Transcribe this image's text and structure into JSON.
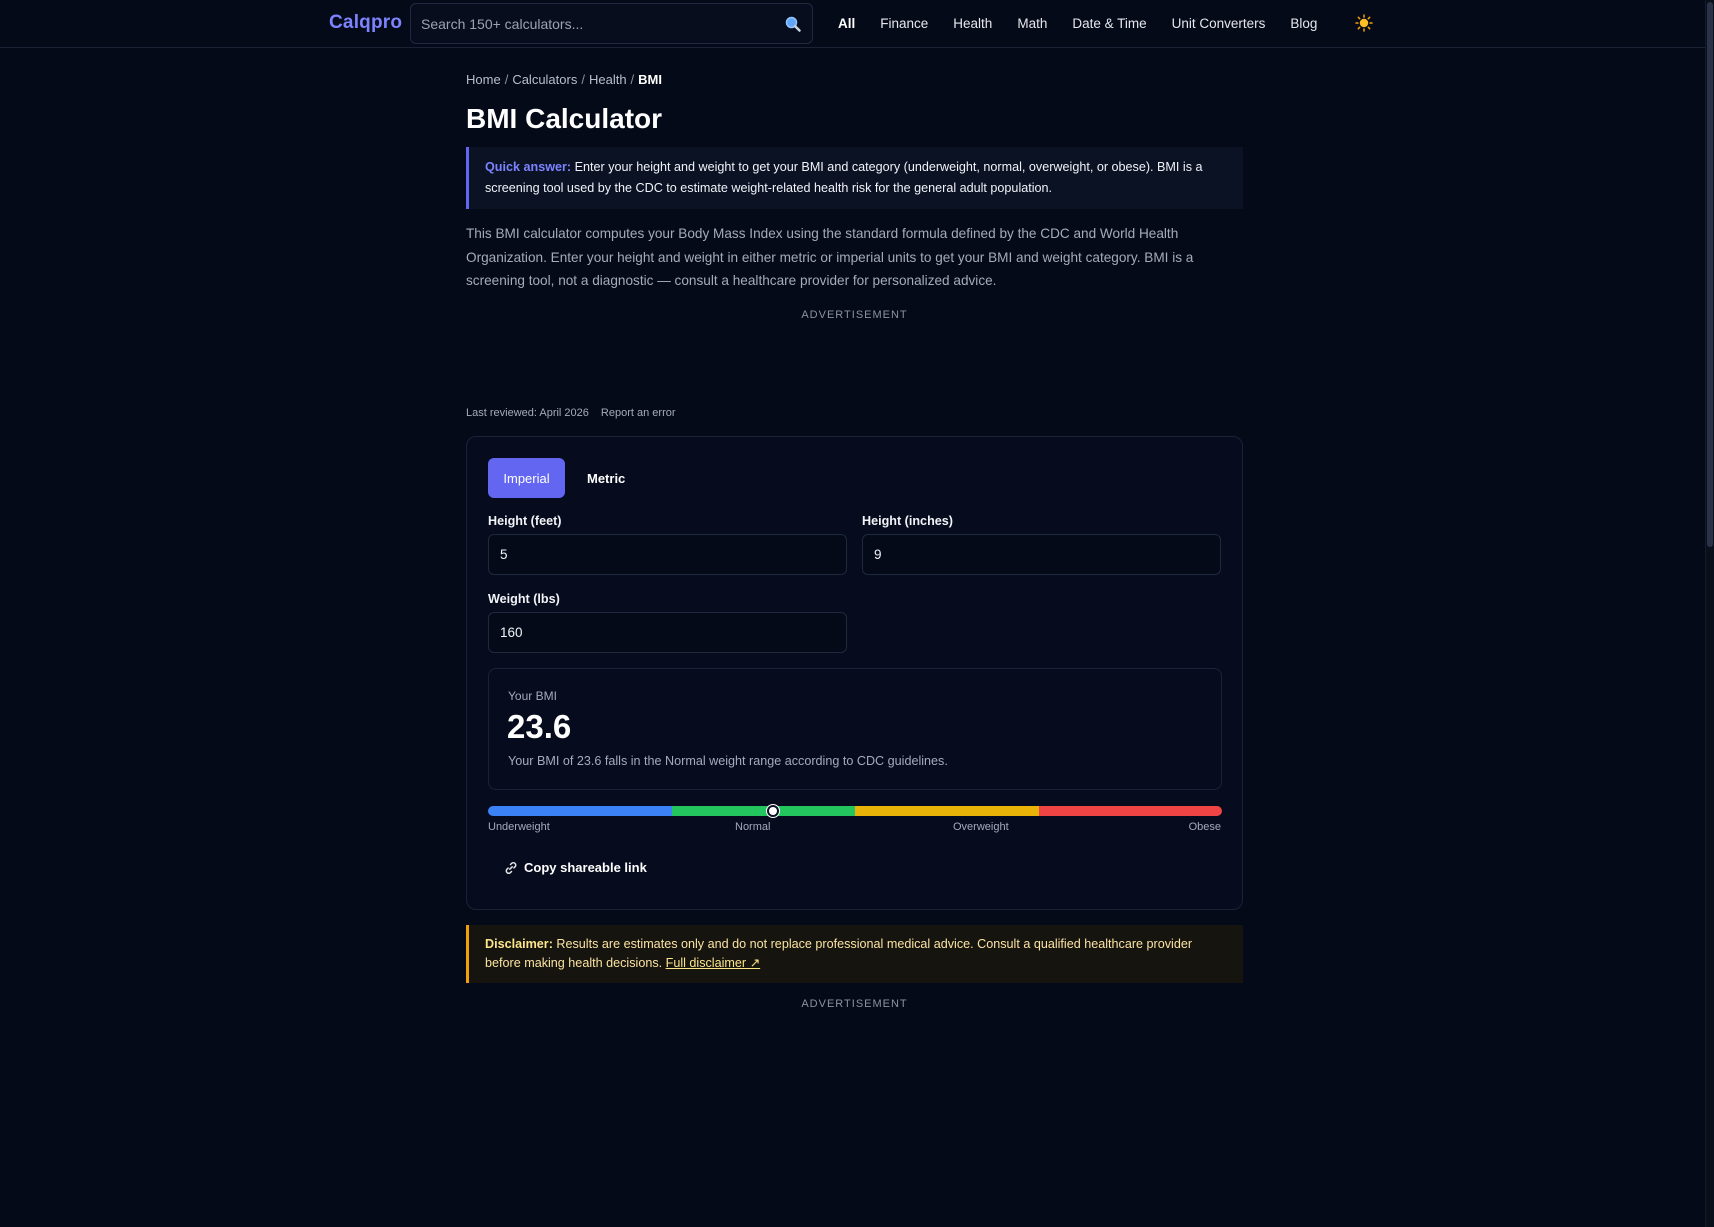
{
  "header": {
    "logo": "Calqpro",
    "search_placeholder": "Search 150+ calculators...",
    "nav": [
      "All",
      "Finance",
      "Health",
      "Math",
      "Date & Time",
      "Unit Converters",
      "Blog"
    ],
    "theme_icon": "sun-icon"
  },
  "breadcrumb": {
    "items": [
      "Home",
      "Calculators",
      "Health"
    ],
    "current": "BMI"
  },
  "page": {
    "title": "BMI Calculator",
    "quick_answer_label": "Quick answer:",
    "quick_answer_text": " Enter your height and weight to get your BMI and category (underweight, normal, overweight, or obese). BMI is a screening tool used by the CDC to estimate weight-related health risk for the general adult population.",
    "intro": "This BMI calculator computes your Body Mass Index using the standard formula defined by the CDC and World Health Organization. Enter your height and weight in either metric or imperial units to get your BMI and weight category. BMI is a screening tool, not a diagnostic — consult a healthcare provider for personalized advice.",
    "ad_label": "ADVERTISEMENT",
    "last_reviewed": "Last reviewed: April 2026",
    "report_error": "Report an error"
  },
  "calculator": {
    "tabs": [
      {
        "label": "Imperial",
        "active": true
      },
      {
        "label": "Metric",
        "active": false
      }
    ],
    "height_feet": {
      "label": "Height (feet)",
      "value": "5"
    },
    "height_inches": {
      "label": "Height (inches)",
      "value": "9"
    },
    "weight": {
      "label": "Weight (lbs)",
      "value": "160"
    },
    "result": {
      "label": "Your BMI",
      "value": "23.6",
      "description": "Your BMI of 23.6 falls in the Normal weight range according to CDC guidelines."
    },
    "scale": {
      "segments": [
        {
          "label": "Underweight",
          "color": "#3b82f6"
        },
        {
          "label": "Normal",
          "color": "#22c55e"
        },
        {
          "label": "Overweight",
          "color": "#eab308"
        },
        {
          "label": "Obese",
          "color": "#ef4444"
        }
      ],
      "marker_fraction": 0.388
    },
    "copy_link": "Copy shareable link"
  },
  "disclaimer": {
    "label": "Disclaimer:",
    "text": " Results are estimates only and do not replace professional medical advice. Consult a qualified healthcare provider before making health decisions. ",
    "link": "Full disclaimer ↗"
  }
}
